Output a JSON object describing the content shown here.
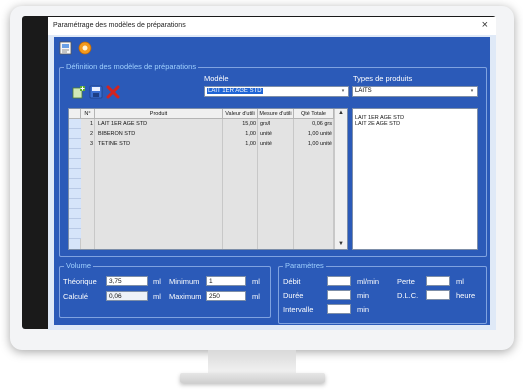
{
  "window": {
    "title": "Paramétrage des modèles de préparations",
    "close": "×"
  },
  "toolbar": {
    "icons": [
      "notes-icon",
      "settings-icon"
    ]
  },
  "definition": {
    "group_label": "Définition des modèles de préparations",
    "model_label": "Modèle",
    "model_value": "LAIT 1ER AGE STD",
    "types_label": "Types de produits",
    "types_value": "LAITS",
    "actions": [
      "add-icon",
      "save-icon",
      "delete-icon"
    ],
    "columns": [
      "N°",
      "Produit",
      "Valeur d'utili",
      "Mesure d'utili",
      "Qté Totale"
    ],
    "rows": [
      {
        "n": "1",
        "produit": "LAIT 1ER AGE STD",
        "valeur": "15,00",
        "mesure": "grs/l",
        "qte": "0,06 grs"
      },
      {
        "n": "2",
        "produit": "BIBERON STD",
        "valeur": "1,00",
        "mesure": "unité",
        "qte": "1,00 unité"
      },
      {
        "n": "3",
        "produit": "TETINE STD",
        "valeur": "1,00",
        "mesure": "unité",
        "qte": "1,00 unité"
      }
    ],
    "types_list": [
      "LAIT 1ER AGE STD",
      "LAIT 2E AGE STD"
    ]
  },
  "volume": {
    "group_label": "Volume",
    "theorique_label": "Théorique",
    "theorique_value": "3,75",
    "theorique_unit": "ml",
    "calcule_label": "Calculé",
    "calcule_value": "0,06",
    "calcule_unit": "ml",
    "minimum_label": "Minimum",
    "minimum_value": "1",
    "minimum_unit": "ml",
    "maximum_label": "Maximum",
    "maximum_value": "250",
    "maximum_unit": "ml"
  },
  "parametres": {
    "group_label": "Paramètres",
    "debit_label": "Débit",
    "debit_value": "",
    "debit_unit": "ml/min",
    "duree_label": "Durée",
    "duree_value": "",
    "duree_unit": "min",
    "intervalle_label": "Intervalle",
    "intervalle_value": "",
    "intervalle_unit": "min",
    "perte_label": "Perte",
    "perte_value": "",
    "perte_unit": "ml",
    "dlc_label": "D.L.C.",
    "dlc_value": "",
    "dlc_unit": "heure"
  },
  "colors": {
    "client_bg": "#2b5ab8",
    "group_label": "#9fd0ff",
    "selection": "#1f65d6"
  }
}
